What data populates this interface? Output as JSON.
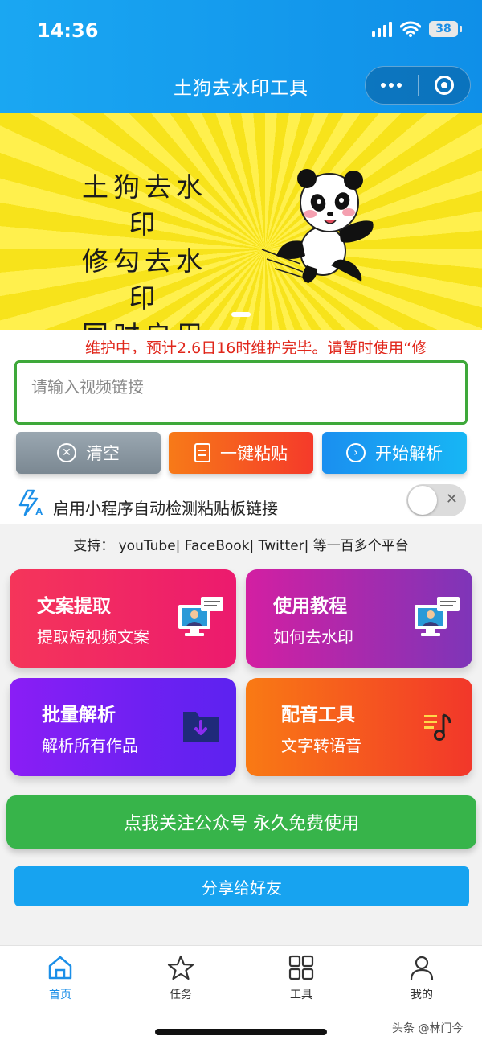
{
  "status_bar": {
    "time": "14:36",
    "battery": "38"
  },
  "nav": {
    "title": "土狗去水印工具",
    "capsule_icons": [
      "more-dots-icon",
      "target-close-icon"
    ]
  },
  "banner": {
    "lines": [
      "土狗去水印",
      "修勾去水印",
      "同时启用"
    ],
    "mascot": "panda-illustration",
    "colors": {
      "yellow": "#fff04d",
      "ray": "#f7e31b"
    }
  },
  "notice": {
    "text": "维护中，预计2.6日16时维护完毕。请暂时使用“修"
  },
  "url_input": {
    "placeholder": "请输入视频链接",
    "value": ""
  },
  "actions": {
    "clear": {
      "label": "清空",
      "icon": "x-circle-icon"
    },
    "paste": {
      "label": "一键粘贴",
      "icon": "document-icon"
    },
    "parse": {
      "label": "开始解析",
      "icon": "chevron-right-circle-icon"
    }
  },
  "auto_detect": {
    "label": "启用小程序自动检测粘贴板链接",
    "enabled": false
  },
  "support": {
    "text": "支持：  youTube| FaceBook| Twitter| 等一百多个平台"
  },
  "cards": [
    {
      "title": "文案提取",
      "subtitle": "提取短视频文案",
      "icon": "monitor-chat-icon"
    },
    {
      "title": "使用教程",
      "subtitle": "如何去水印",
      "icon": "monitor-chat-icon"
    },
    {
      "title": "批量解析",
      "subtitle": "解析所有作品",
      "icon": "folder-download-icon"
    },
    {
      "title": "配音工具",
      "subtitle": "文字转语音",
      "icon": "music-list-icon"
    }
  ],
  "follow_button": {
    "label": "点我关注公众号 永久免费使用"
  },
  "share_button": {
    "label": "分享给好友"
  },
  "tabbar": {
    "items": [
      {
        "label": "首页",
        "icon": "home-icon",
        "active": true
      },
      {
        "label": "任务",
        "icon": "star-icon",
        "active": false
      },
      {
        "label": "工具",
        "icon": "grid-icon",
        "active": false
      },
      {
        "label": "我的",
        "icon": "user-icon",
        "active": false
      }
    ]
  },
  "watermark": {
    "text": "头条 @林门今"
  },
  "colors": {
    "accent": "#1b8fe8",
    "notice_red": "#e0261a",
    "input_border": "#3ea83a",
    "follow_green": "#37b44a"
  }
}
